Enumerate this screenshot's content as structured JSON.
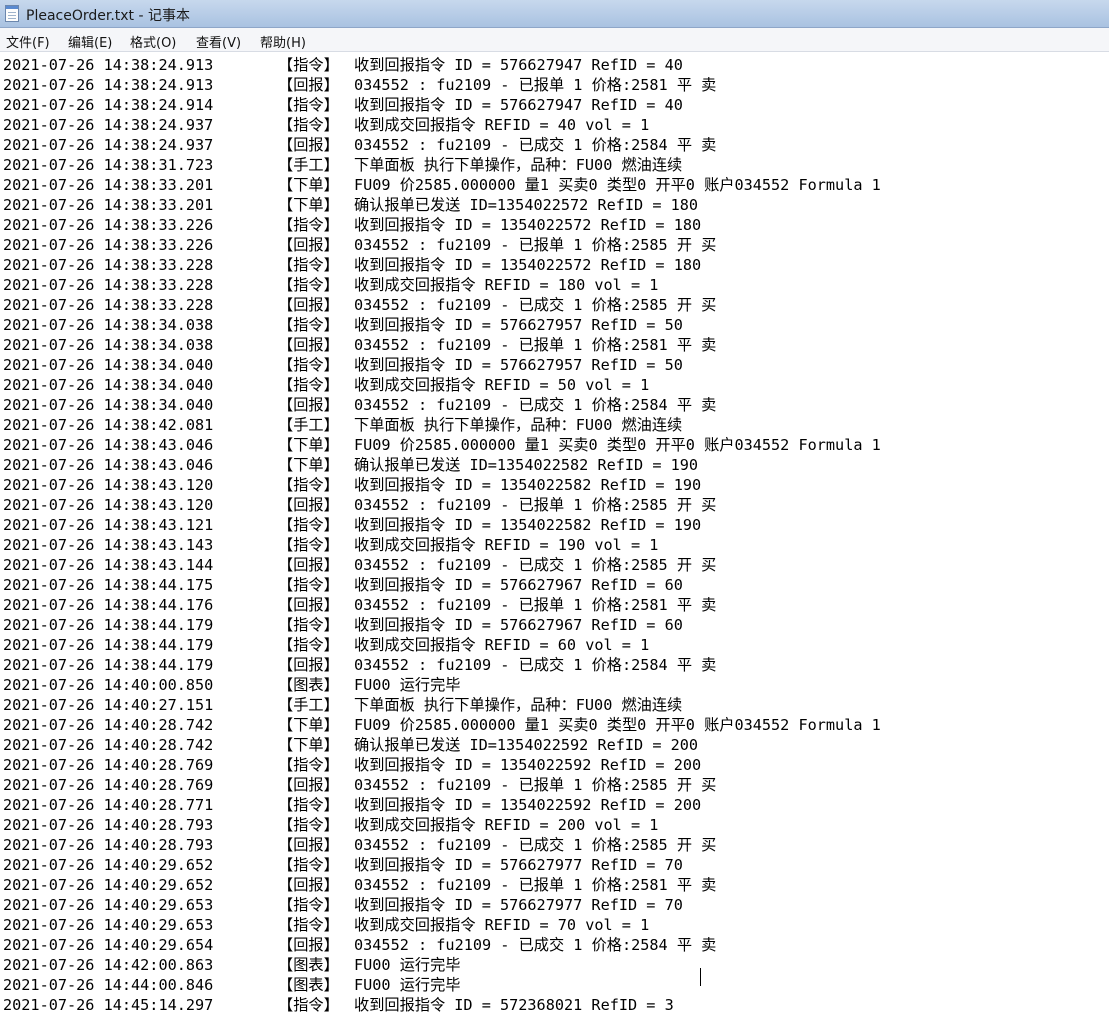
{
  "window": {
    "title": "PleaceOrder.txt - 记事本",
    "icon": "notepad-icon"
  },
  "menu": [
    {
      "label": "文件(F)"
    },
    {
      "label": "编辑(E)"
    },
    {
      "label": "格式(O)"
    },
    {
      "label": "查看(V)"
    },
    {
      "label": "帮助(H)"
    }
  ],
  "log": [
    {
      "ts": "2021-07-26 14:38:24.913",
      "tag": "【指令】",
      "msg": "收到回报指令 ID = 576627947 RefID = 40"
    },
    {
      "ts": "2021-07-26 14:38:24.913",
      "tag": "【回报】",
      "msg": "034552 : fu2109 - 已报单 1 价格:2581 平 卖"
    },
    {
      "ts": "2021-07-26 14:38:24.914",
      "tag": "【指令】",
      "msg": "收到回报指令 ID = 576627947 RefID = 40"
    },
    {
      "ts": "2021-07-26 14:38:24.937",
      "tag": "【指令】",
      "msg": "收到成交回报指令 REFID = 40 vol = 1"
    },
    {
      "ts": "2021-07-26 14:38:24.937",
      "tag": "【回报】",
      "msg": "034552 : fu2109 - 已成交 1 价格:2584 平 卖"
    },
    {
      "ts": "2021-07-26 14:38:31.723",
      "tag": "【手工】",
      "msg": "下单面板 执行下单操作，品种：FU00 燃油连续"
    },
    {
      "ts": "2021-07-26 14:38:33.201",
      "tag": "【下单】",
      "msg": "FU09 价2585.000000 量1 买卖0 类型0 开平0 账户034552 Formula 1"
    },
    {
      "ts": "2021-07-26 14:38:33.201",
      "tag": "【下单】",
      "msg": "确认报单已发送 ID=1354022572 RefID = 180"
    },
    {
      "ts": "2021-07-26 14:38:33.226",
      "tag": "【指令】",
      "msg": "收到回报指令 ID = 1354022572 RefID = 180"
    },
    {
      "ts": "2021-07-26 14:38:33.226",
      "tag": "【回报】",
      "msg": "034552 : fu2109 - 已报单 1 价格:2585 开 买"
    },
    {
      "ts": "2021-07-26 14:38:33.228",
      "tag": "【指令】",
      "msg": "收到回报指令 ID = 1354022572 RefID = 180"
    },
    {
      "ts": "2021-07-26 14:38:33.228",
      "tag": "【指令】",
      "msg": "收到成交回报指令 REFID = 180 vol = 1"
    },
    {
      "ts": "2021-07-26 14:38:33.228",
      "tag": "【回报】",
      "msg": "034552 : fu2109 - 已成交 1 价格:2585 开 买"
    },
    {
      "ts": "2021-07-26 14:38:34.038",
      "tag": "【指令】",
      "msg": "收到回报指令 ID = 576627957 RefID = 50"
    },
    {
      "ts": "2021-07-26 14:38:34.038",
      "tag": "【回报】",
      "msg": "034552 : fu2109 - 已报单 1 价格:2581 平 卖"
    },
    {
      "ts": "2021-07-26 14:38:34.040",
      "tag": "【指令】",
      "msg": "收到回报指令 ID = 576627957 RefID = 50"
    },
    {
      "ts": "2021-07-26 14:38:34.040",
      "tag": "【指令】",
      "msg": "收到成交回报指令 REFID = 50 vol = 1"
    },
    {
      "ts": "2021-07-26 14:38:34.040",
      "tag": "【回报】",
      "msg": "034552 : fu2109 - 已成交 1 价格:2584 平 卖"
    },
    {
      "ts": "2021-07-26 14:38:42.081",
      "tag": "【手工】",
      "msg": "下单面板 执行下单操作，品种：FU00 燃油连续"
    },
    {
      "ts": "2021-07-26 14:38:43.046",
      "tag": "【下单】",
      "msg": "FU09 价2585.000000 量1 买卖0 类型0 开平0 账户034552 Formula 1"
    },
    {
      "ts": "2021-07-26 14:38:43.046",
      "tag": "【下单】",
      "msg": "确认报单已发送 ID=1354022582 RefID = 190"
    },
    {
      "ts": "2021-07-26 14:38:43.120",
      "tag": "【指令】",
      "msg": "收到回报指令 ID = 1354022582 RefID = 190"
    },
    {
      "ts": "2021-07-26 14:38:43.120",
      "tag": "【回报】",
      "msg": "034552 : fu2109 - 已报单 1 价格:2585 开 买"
    },
    {
      "ts": "2021-07-26 14:38:43.121",
      "tag": "【指令】",
      "msg": "收到回报指令 ID = 1354022582 RefID = 190"
    },
    {
      "ts": "2021-07-26 14:38:43.143",
      "tag": "【指令】",
      "msg": "收到成交回报指令 REFID = 190 vol = 1"
    },
    {
      "ts": "2021-07-26 14:38:43.144",
      "tag": "【回报】",
      "msg": "034552 : fu2109 - 已成交 1 价格:2585 开 买"
    },
    {
      "ts": "2021-07-26 14:38:44.175",
      "tag": "【指令】",
      "msg": "收到回报指令 ID = 576627967 RefID = 60"
    },
    {
      "ts": "2021-07-26 14:38:44.176",
      "tag": "【回报】",
      "msg": "034552 : fu2109 - 已报单 1 价格:2581 平 卖"
    },
    {
      "ts": "2021-07-26 14:38:44.179",
      "tag": "【指令】",
      "msg": "收到回报指令 ID = 576627967 RefID = 60"
    },
    {
      "ts": "2021-07-26 14:38:44.179",
      "tag": "【指令】",
      "msg": "收到成交回报指令 REFID = 60 vol = 1"
    },
    {
      "ts": "2021-07-26 14:38:44.179",
      "tag": "【回报】",
      "msg": "034552 : fu2109 - 已成交 1 价格:2584 平 卖"
    },
    {
      "ts": "2021-07-26 14:40:00.850",
      "tag": "【图表】",
      "msg": "FU00 运行完毕"
    },
    {
      "ts": "2021-07-26 14:40:27.151",
      "tag": "【手工】",
      "msg": "下单面板 执行下单操作，品种：FU00 燃油连续"
    },
    {
      "ts": "2021-07-26 14:40:28.742",
      "tag": "【下单】",
      "msg": "FU09 价2585.000000 量1 买卖0 类型0 开平0 账户034552 Formula 1"
    },
    {
      "ts": "2021-07-26 14:40:28.742",
      "tag": "【下单】",
      "msg": "确认报单已发送 ID=1354022592 RefID = 200"
    },
    {
      "ts": "2021-07-26 14:40:28.769",
      "tag": "【指令】",
      "msg": "收到回报指令 ID = 1354022592 RefID = 200"
    },
    {
      "ts": "2021-07-26 14:40:28.769",
      "tag": "【回报】",
      "msg": "034552 : fu2109 - 已报单 1 价格:2585 开 买"
    },
    {
      "ts": "2021-07-26 14:40:28.771",
      "tag": "【指令】",
      "msg": "收到回报指令 ID = 1354022592 RefID = 200"
    },
    {
      "ts": "2021-07-26 14:40:28.793",
      "tag": "【指令】",
      "msg": "收到成交回报指令 REFID = 200 vol = 1"
    },
    {
      "ts": "2021-07-26 14:40:28.793",
      "tag": "【回报】",
      "msg": "034552 : fu2109 - 已成交 1 价格:2585 开 买"
    },
    {
      "ts": "2021-07-26 14:40:29.652",
      "tag": "【指令】",
      "msg": "收到回报指令 ID = 576627977 RefID = 70"
    },
    {
      "ts": "2021-07-26 14:40:29.652",
      "tag": "【回报】",
      "msg": "034552 : fu2109 - 已报单 1 价格:2581 平 卖"
    },
    {
      "ts": "2021-07-26 14:40:29.653",
      "tag": "【指令】",
      "msg": "收到回报指令 ID = 576627977 RefID = 70"
    },
    {
      "ts": "2021-07-26 14:40:29.653",
      "tag": "【指令】",
      "msg": "收到成交回报指令 REFID = 70 vol = 1"
    },
    {
      "ts": "2021-07-26 14:40:29.654",
      "tag": "【回报】",
      "msg": "034552 : fu2109 - 已成交 1 价格:2584 平 卖"
    },
    {
      "ts": "2021-07-26 14:42:00.863",
      "tag": "【图表】",
      "msg": "FU00 运行完毕"
    },
    {
      "ts": "2021-07-26 14:44:00.846",
      "tag": "【图表】",
      "msg": "FU00 运行完毕"
    },
    {
      "ts": "2021-07-26 14:45:14.297",
      "tag": "【指令】",
      "msg": "收到回报指令 ID = 572368021 RefID = 3"
    }
  ]
}
